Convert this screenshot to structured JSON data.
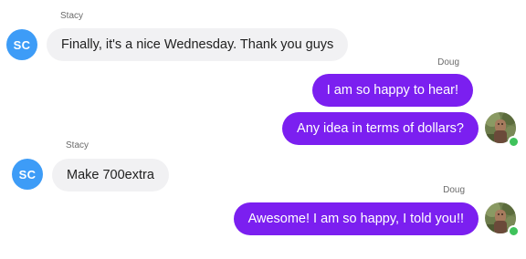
{
  "colors": {
    "incoming_bubble": "#f1f1f3",
    "outgoing_bubble": "#7b1ff0",
    "initials_avatar": "#3d9cf7",
    "online_status": "#3fc25b"
  },
  "messages": [
    {
      "sender": "Stacy",
      "initials": "SC",
      "text": "Finally, it's a nice Wednesday. Thank you guys",
      "direction": "incoming"
    },
    {
      "sender": "Doug",
      "text": "I am so happy to hear!",
      "direction": "outgoing"
    },
    {
      "text": "Any idea in terms of dollars?",
      "direction": "outgoing",
      "avatar_icon": "user-photo-icon",
      "status": "online"
    },
    {
      "sender": "Stacy",
      "initials": "SC",
      "text": "Make 700extra",
      "direction": "incoming"
    },
    {
      "sender": "Doug",
      "text": "Awesome! I am so happy, I told you!!",
      "direction": "outgoing",
      "avatar_icon": "user-photo-icon",
      "status": "online"
    }
  ]
}
